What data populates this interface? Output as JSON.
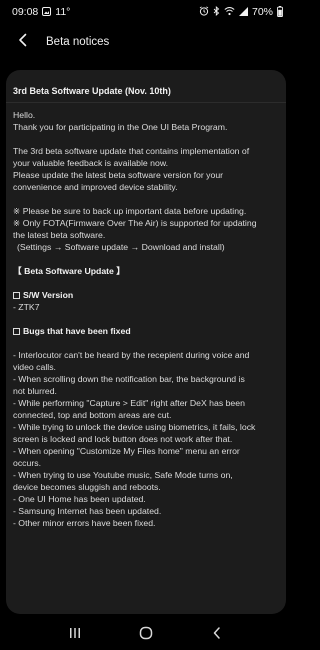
{
  "status_bar": {
    "time": "09:08",
    "notification_icon": "gallery-icon",
    "temperature": "11°",
    "alarm_icon": "alarm-icon",
    "bluetooth_icon": "bluetooth-icon",
    "wifi_icon": "wifi-icon",
    "signal_icon": "signal-icon",
    "battery": "70%",
    "battery_icon": "battery-icon"
  },
  "app_bar": {
    "back_icon": "chevron-left-icon",
    "title": "Beta notices"
  },
  "notice": {
    "title": "3rd Beta Software Update (Nov. 10th)",
    "greeting": "Hello.",
    "thanks": "Thank you for participating in the One UI Beta Program.",
    "intro_lines": [
      "The 3rd beta software update that contains implementation of",
      "your valuable feedback is available now.",
      "Please update the latest beta software version for your",
      "convenience and improved device stability."
    ],
    "warnings": [
      "※ Please be sure to back up important data before updating.",
      "※ Only FOTA(Firmware Over The Air) is supported for updating",
      "the latest beta software.",
      "(Settings → Software update → Download and install)"
    ],
    "section_title": "【 Beta Software Update 】",
    "sw_version_heading": "S/W Version",
    "sw_version_value": "- ZTK7",
    "bugs_heading": "Bugs that have been fixed",
    "bug_lines": [
      "- Interlocutor can't be heard by the recepient during voice and",
      "video calls.",
      "- When scrolling down the notification bar, the background is",
      "not blurred.",
      "- While performing \"Capture > Edit\" right after DeX has been",
      "connected, top and bottom areas are cut.",
      "- While trying to unlock the device using biometrics, it fails, lock",
      "screen is locked and lock button does not work after that.",
      "- When opening \"Customize My Files home\" menu an error",
      "occurs.",
      "- When trying to use Youtube music, Safe Mode turns on,",
      "device becomes sluggish and reboots.",
      "- One UI Home has been updated.",
      "- Samsung Internet has been updated.",
      "- Other minor errors have been fixed."
    ]
  },
  "nav_bar": {
    "recents_icon": "recent-apps-icon",
    "home_icon": "home-icon",
    "back_icon": "back-icon"
  }
}
